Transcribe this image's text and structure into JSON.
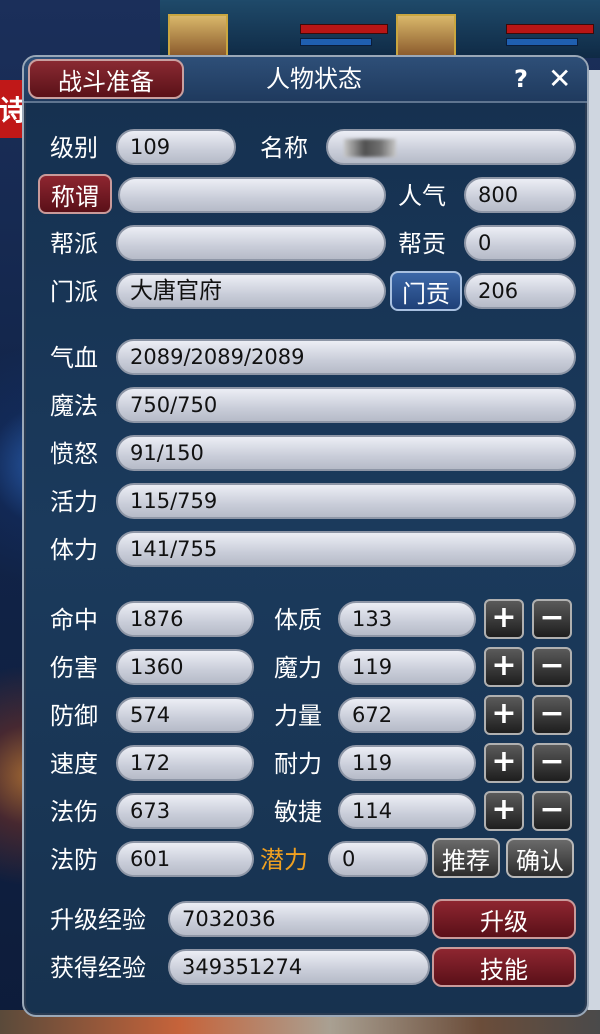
{
  "header": {
    "battle_tab": "战斗准备",
    "title": "人物状态",
    "help": "?",
    "close": "✕"
  },
  "background": {
    "sign_char": "诗"
  },
  "profile": {
    "level_label": "级别",
    "level": "109",
    "name_label": "名称",
    "title_btn": "称谓",
    "title_value": "",
    "popularity_label": "人气",
    "popularity": "800",
    "guild_label": "帮派",
    "guild": "",
    "guild_contrib_label": "帮贡",
    "guild_contrib": "0",
    "school_label": "门派",
    "school": "大唐官府",
    "school_contrib_btn": "门贡",
    "school_contrib": "206"
  },
  "vitals": {
    "hp_label": "气血",
    "hp": "2089/2089/2089",
    "mp_label": "魔法",
    "mp": "750/750",
    "rage_label": "愤怒",
    "rage": "91/150",
    "vitality_label": "活力",
    "vitality": "115/759",
    "stamina_label": "体力",
    "stamina": "141/755"
  },
  "stats": {
    "hit_label": "命中",
    "hit": "1876",
    "damage_label": "伤害",
    "damage": "1360",
    "defense_label": "防御",
    "defense": "574",
    "speed_label": "速度",
    "speed": "172",
    "mag_dmg_label": "法伤",
    "mag_dmg": "673",
    "mag_def_label": "法防",
    "mag_def": "601"
  },
  "attributes": {
    "constitution_label": "体质",
    "constitution": "133",
    "magic_label": "魔力",
    "magic": "119",
    "strength_label": "力量",
    "strength": "672",
    "endurance_label": "耐力",
    "endurance": "119",
    "agility_label": "敏捷",
    "agility": "114",
    "potential_label": "潜力",
    "potential": "0",
    "plus": "+",
    "minus": "−",
    "recommend_btn": "推荐",
    "confirm_btn": "确认"
  },
  "experience": {
    "levelup_exp_label": "升级经验",
    "levelup_exp": "7032036",
    "gained_exp_label": "获得经验",
    "gained_exp": "349351274",
    "levelup_btn": "升级",
    "skills_btn": "技能"
  },
  "colors": {
    "panel_bg": "#17324f",
    "field_bg": "#c9cdd9",
    "red_button": "#5a1018",
    "potential_label": "#f0a020"
  }
}
